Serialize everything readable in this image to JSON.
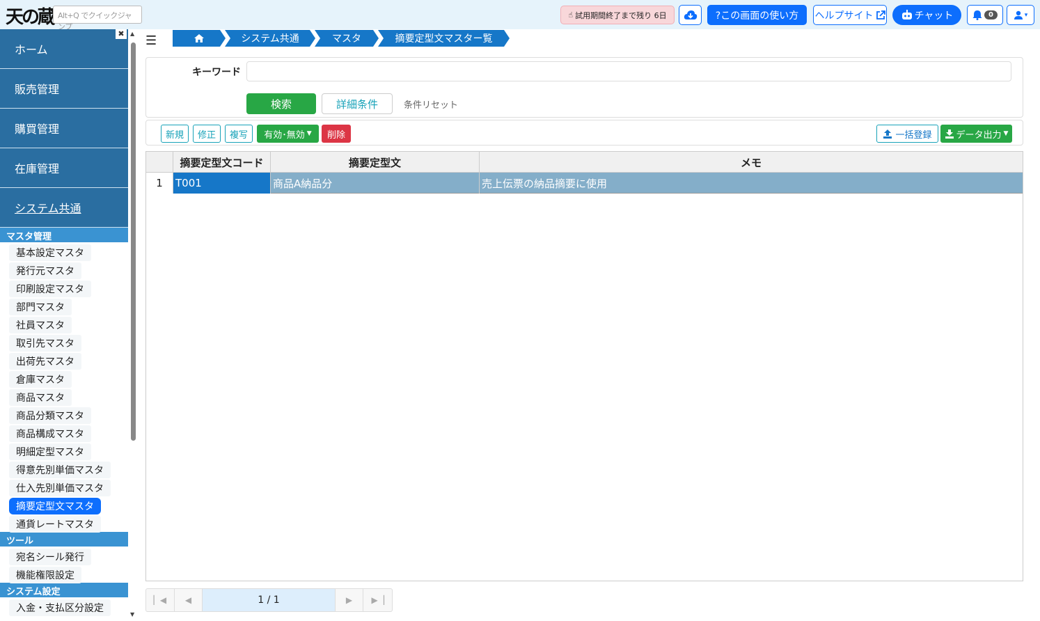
{
  "app": {
    "logo_text": "天の蔵"
  },
  "topbar": {
    "quickjump_placeholder": "Alt+Q でクイックジャンプ",
    "trial_notice": "試用期間終了まで残り 6日",
    "howto_label": "?この画面の使い方",
    "helpsite_label": "ヘルプサイト",
    "chat_label": "チャット",
    "notification_count": "0"
  },
  "sidebar": {
    "main_items": [
      {
        "label": "ホーム"
      },
      {
        "label": "販売管理"
      },
      {
        "label": "購買管理"
      },
      {
        "label": "在庫管理"
      },
      {
        "label": "システム共通"
      }
    ],
    "sections": [
      {
        "title": "マスタ管理",
        "items": [
          "基本設定マスタ",
          "発行元マスタ",
          "印刷設定マスタ",
          "部門マスタ",
          "社員マスタ",
          "取引先マスタ",
          "出荷先マスタ",
          "倉庫マスタ",
          "商品マスタ",
          "商品分類マスタ",
          "商品構成マスタ",
          "明細定型マスタ",
          "得意先別単価マスタ",
          "仕入先別単価マスタ",
          "摘要定型文マスタ",
          "通貨レートマスタ"
        ]
      },
      {
        "title": "ツール",
        "items": [
          "宛名シール発行",
          "機能権限設定"
        ]
      },
      {
        "title": "システム設定",
        "items": [
          "入金・支払区分設定"
        ]
      }
    ],
    "active_item": "摘要定型文マスタ"
  },
  "breadcrumb": [
    "システム共通",
    "マスタ",
    "摘要定型文マスター覧"
  ],
  "search": {
    "keyword_label": "キーワード",
    "keyword_value": "",
    "search_label": "検索",
    "detail_label": "詳細条件",
    "reset_label": "条件リセット"
  },
  "toolbar": {
    "new_label": "新規",
    "edit_label": "修正",
    "copy_label": "複写",
    "validity_label": "有効･無効",
    "delete_label": "削除",
    "bulk_label": "一括登録",
    "export_label": "データ出力"
  },
  "table": {
    "columns": [
      "摘要定型文コード",
      "摘要定型文",
      "メモ"
    ],
    "rows": [
      {
        "num": "1",
        "code": "T001",
        "text": "商品A納品分",
        "memo": "売上伝票の納品摘要に使用"
      }
    ]
  },
  "pager": {
    "text": "1 / 1"
  }
}
